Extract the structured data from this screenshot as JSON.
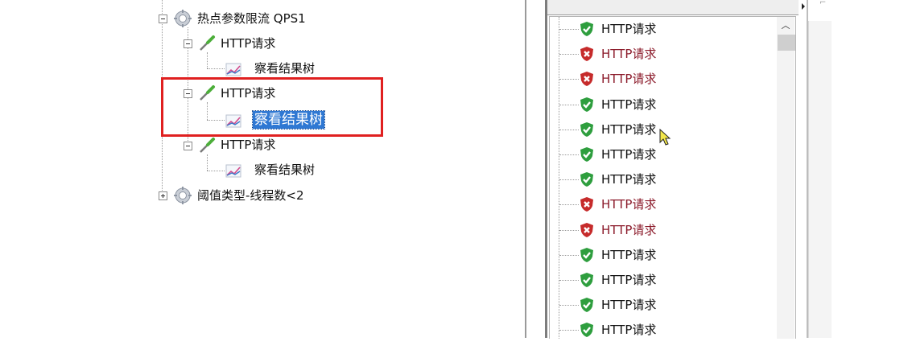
{
  "tree": {
    "groups": [
      {
        "label": "热点参数限流 QPS1",
        "expanded": true,
        "samplers": [
          {
            "label": "HTTP请求",
            "listener": "察看结果树",
            "listener_selected": false
          },
          {
            "label": "HTTP请求",
            "listener": "察看结果树",
            "listener_selected": true
          },
          {
            "label": "HTTP请求",
            "listener": "察看结果树",
            "listener_selected": false
          }
        ]
      },
      {
        "label": "阈值类型-线程数<2",
        "expanded": false
      }
    ]
  },
  "results": {
    "label": "HTTP请求",
    "rows": [
      "success",
      "error",
      "error",
      "success",
      "success",
      "success",
      "success",
      "error",
      "error",
      "success",
      "success",
      "success",
      "success"
    ],
    "colors": {
      "success": "#2e9e3e",
      "error": "#c62b2b",
      "error_text": "#8b1a2a"
    }
  },
  "highlight": {
    "color": "#e02020"
  },
  "selection_color": "#2f78d3"
}
